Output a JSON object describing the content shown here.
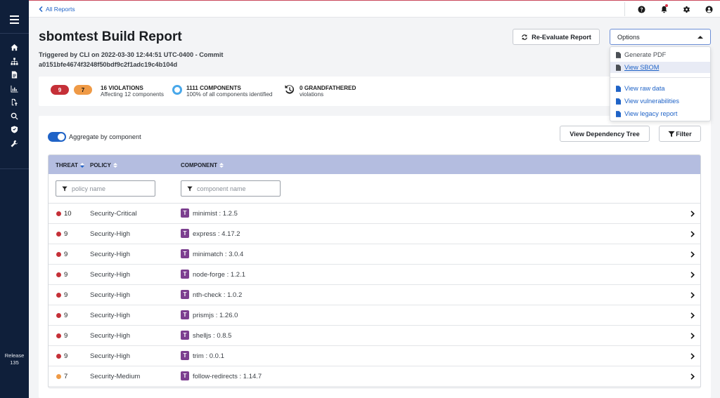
{
  "colors": {
    "sidebar_bg": "#0f1f3a",
    "link": "#1f63c7",
    "critical": "#c53038",
    "high": "#c53038",
    "medium": "#ef9a46",
    "table_header": "#b4bde0",
    "tag": "#7c3f8f"
  },
  "sidebar": {
    "menu_icon": "hamburger-icon",
    "items": [
      {
        "icon": "home-icon"
      },
      {
        "icon": "sitemap-icon"
      },
      {
        "icon": "document-icon"
      },
      {
        "icon": "chart-icon"
      },
      {
        "icon": "upload-icon"
      },
      {
        "icon": "search-icon"
      },
      {
        "icon": "shield-icon"
      },
      {
        "icon": "wrench-icon"
      }
    ],
    "release_label": "Release",
    "release_number": "135"
  },
  "topbar": {
    "back_label": "All Reports",
    "icons": [
      "help-icon",
      "bell-icon",
      "gear-icon",
      "user-icon"
    ]
  },
  "header": {
    "title": "sbomtest Build Report",
    "subtitle_line1": "Triggered by CLI on 2022-03-30 12:44:51 UTC-0400 - Commit",
    "subtitle_line2": "a0151bfe4674f3248f50bdf9c2f1adc19c4b104d",
    "reevaluate_label": "Re-Evaluate Report",
    "options_label": "Options"
  },
  "options_menu": {
    "items": [
      {
        "label": "Generate PDF"
      },
      {
        "label": "View SBOM"
      },
      {
        "label": "View raw data"
      },
      {
        "label": "View vulnerabilities"
      },
      {
        "label": "View legacy report"
      }
    ]
  },
  "summary": {
    "critical_count": "9",
    "high_count": "7",
    "violations_title": "16 VIOLATIONS",
    "violations_sub": "Affecting 12 components",
    "components_title": "1111 COMPONENTS",
    "components_sub": "100% of all components identified",
    "grandfathered_title": "0 GRANDFATHERED",
    "grandfathered_sub": "violations"
  },
  "panel": {
    "aggregate_label": "Aggregate by component",
    "dependency_tree_label": "View Dependency Tree",
    "filter_label": "Filter"
  },
  "table": {
    "columns": {
      "threat": "THREAT",
      "policy": "POLICY",
      "component": "COMPONENT"
    },
    "policy_placeholder": "policy name",
    "component_placeholder": "component name",
    "rows": [
      {
        "threat": "10",
        "level": "critical",
        "policy": "Security-Critical",
        "tag": "T",
        "component": "minimist : 1.2.5"
      },
      {
        "threat": "9",
        "level": "high",
        "policy": "Security-High",
        "tag": "T",
        "component": "express : 4.17.2"
      },
      {
        "threat": "9",
        "level": "high",
        "policy": "Security-High",
        "tag": "T",
        "component": "minimatch : 3.0.4"
      },
      {
        "threat": "9",
        "level": "high",
        "policy": "Security-High",
        "tag": "T",
        "component": "node-forge : 1.2.1"
      },
      {
        "threat": "9",
        "level": "high",
        "policy": "Security-High",
        "tag": "T",
        "component": "nth-check : 1.0.2"
      },
      {
        "threat": "9",
        "level": "high",
        "policy": "Security-High",
        "tag": "T",
        "component": "prismjs : 1.26.0"
      },
      {
        "threat": "9",
        "level": "high",
        "policy": "Security-High",
        "tag": "T",
        "component": "shelljs : 0.8.5"
      },
      {
        "threat": "9",
        "level": "high",
        "policy": "Security-High",
        "tag": "T",
        "component": "trim : 0.0.1"
      },
      {
        "threat": "7",
        "level": "medium",
        "policy": "Security-Medium",
        "tag": "T",
        "component": "follow-redirects : 1.14.7"
      }
    ]
  }
}
